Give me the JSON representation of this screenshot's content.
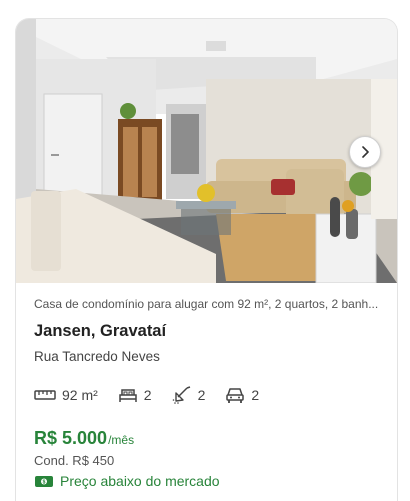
{
  "listing": {
    "description": "Casa de condomínio para alugar com 92 m², 2 quartos, 2 banh...",
    "neighborhood_city": "Jansen, Gravataí",
    "street": "Rua Tancredo Neves",
    "features": {
      "area": "92 m²",
      "bedrooms": "2",
      "bathrooms": "2",
      "parking": "2"
    },
    "price": "R$ 5.000",
    "price_period": "/mês",
    "condo_fee": "Cond. R$ 450",
    "deal_badge": "Preço abaixo do mercado"
  },
  "icons": {
    "next": "chevron-right-icon",
    "area": "ruler-icon",
    "bedrooms": "bed-icon",
    "bathrooms": "shower-icon",
    "parking": "car-icon",
    "deal": "money-icon"
  },
  "colors": {
    "price_green": "#28843a",
    "text_dark": "#222222",
    "text_muted": "#555555"
  }
}
